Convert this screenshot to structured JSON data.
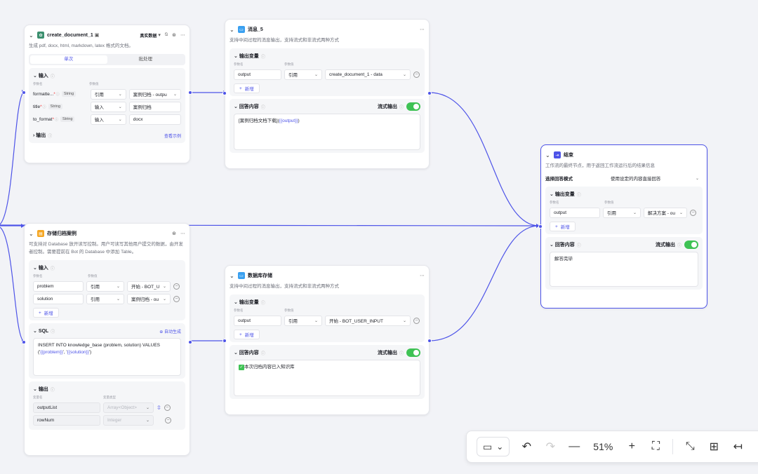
{
  "nodes": {
    "create_doc": {
      "title": "create_document_1",
      "tag": "真实数据",
      "desc": "生成 pdf, docx, html, markdown, latex 格式的文档。",
      "tabs": [
        "单次",
        "批处理"
      ],
      "input_title": "输入",
      "col_name": "参数名",
      "col_value": "参数值",
      "params": [
        {
          "name": "formatte...",
          "type": "String",
          "mode": "引用",
          "value": "案例归档 - outpu"
        },
        {
          "name": "title",
          "type": "String",
          "mode": "输入",
          "value": "案例归档"
        },
        {
          "name": "to_format",
          "type": "String",
          "mode": "输入",
          "value": "docx"
        }
      ],
      "output_title": "输出",
      "output_link": "查看示例"
    },
    "msg5": {
      "title": "消息_5",
      "desc": "支持中间过程的消息输出，支持流式和非流式两种方式",
      "out_title": "输出变量",
      "col_name": "参数名",
      "col_value": "参数值",
      "var_name": "output",
      "var_mode": "引用",
      "var_value": "create_document_1 - data",
      "add": "新增",
      "answer_title": "回答内容",
      "stream_label": "流式输出",
      "answer_prefix": "[案例归档文档下载](",
      "answer_var": "{{output}}",
      "answer_suffix": ")"
    },
    "db": {
      "title": "存储归档案例",
      "desc": "可支持对 Database 放开读写控制。用户可读写其他用户提交的数据，由开发者控制。需要提前在 Bot 的 Database 中添加 Table。",
      "input_title": "输入",
      "col_name": "参数名",
      "col_value": "参数值",
      "params": [
        {
          "name": "problem",
          "mode": "引用",
          "value": "开始 - BOT_U"
        },
        {
          "name": "solution",
          "mode": "引用",
          "value": "案例归档 - ou"
        }
      ],
      "add": "新增",
      "sql_title": "SQL",
      "sql_auto": "自动生成",
      "sql_line1": "INSERT INTO knowledge_base (problem, solution) VALUES",
      "sql_line2_a": "('",
      "sql_var1": "{{problem}}",
      "sql_line2_b": "', '",
      "sql_var2": "{{solution}}",
      "sql_line2_c": "')",
      "output_title": "输出",
      "out_col_name": "变量名",
      "out_col_type": "变量类型",
      "outputs": [
        {
          "name": "outputList",
          "type": "Array<Object>"
        },
        {
          "name": "rowNum",
          "type": "Integer"
        }
      ]
    },
    "dbstore": {
      "title": "数据库存储",
      "desc": "支持中间过程的消息输出，支持流式和非流式两种方式",
      "out_title": "输出变量",
      "col_name": "参数名",
      "col_value": "参数值",
      "var_name": "output",
      "var_mode": "引用",
      "var_value": "开始 - BOT_USER_INPUT",
      "add": "新增",
      "answer_title": "回答内容",
      "stream_label": "流式输出",
      "answer": "本次归档内容已入知识库"
    },
    "end": {
      "title": "结束",
      "desc": "工作流的最终节点，用于返回工作流运行后的结果信息",
      "mode_label": "选择回答模式",
      "mode_value": "使用设定的内容直接回答",
      "out_title": "输出变量",
      "col_name": "参数名",
      "col_value": "参数值",
      "var_name": "output",
      "var_mode": "引用",
      "var_value": "解决方案 - ou",
      "add": "新增",
      "answer_title": "回答内容",
      "stream_label": "流式输出",
      "answer": "解答完毕"
    }
  },
  "toolbar": {
    "zoom": "51%"
  },
  "colors": {
    "accent": "#4d53e8",
    "toggle_on": "#3ec254"
  }
}
